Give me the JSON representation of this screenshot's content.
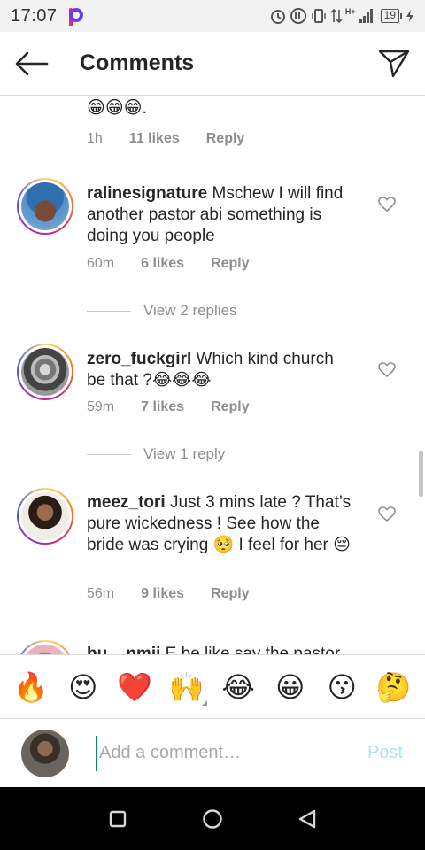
{
  "status_bar": {
    "time": "17:07",
    "battery": "19",
    "network": "H+"
  },
  "header": {
    "title": "Comments",
    "back_icon": "arrow-left-icon",
    "share_icon": "paper-plane-icon"
  },
  "partial_comment": {
    "emojis": "😁😁😁.",
    "time": "1h",
    "likes": "11 likes",
    "reply": "Reply"
  },
  "comments": [
    {
      "username": "ralinesignature",
      "text": " Mschew I will find another pastor abi something is doing you people",
      "time": "60m",
      "likes": "6 likes",
      "reply": "Reply",
      "view_replies": "View 2 replies"
    },
    {
      "username": "zero_fuckgirl",
      "text": " Which kind church be that ?😂😂😂",
      "time": "59m",
      "likes": "7 likes",
      "reply": "Reply",
      "view_replies": "View 1 reply"
    },
    {
      "username": "meez_tori",
      "text": " Just 3 mins late ? That’s pure wickedness ! See how the bride was crying 🥺 I feel for her 😔",
      "time": "56m",
      "likes": "9 likes",
      "reply": "Reply"
    },
    {
      "username": "bu__nmii",
      "text": " E be like say the pastor"
    }
  ],
  "emoji_bar": [
    "🔥",
    "😍",
    "❤️",
    "🙌",
    "😂",
    "😀",
    "😗",
    "🤔"
  ],
  "input": {
    "placeholder": "Add a comment…",
    "post_label": "Post"
  },
  "colors": {
    "accent": "#0095f6",
    "post_disabled": "#b2dffc",
    "secondary_text": "#8e8e8e"
  }
}
